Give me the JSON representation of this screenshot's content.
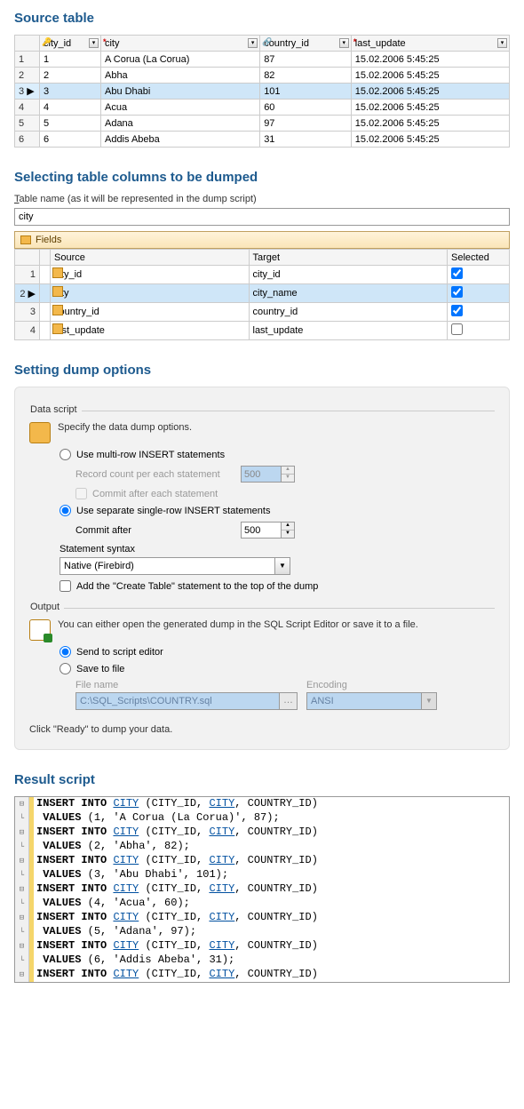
{
  "h_source": "Source table",
  "h_select": "Selecting table columns to be dumped",
  "h_options": "Setting dump options",
  "h_result": "Result script",
  "source_table": {
    "cols": [
      "city_id",
      "city",
      "country_id",
      "last_update"
    ],
    "rows": [
      {
        "n": "1",
        "city_id": "1",
        "city": "A Corua (La Corua)",
        "country_id": "87",
        "last_update": "15.02.2006 5:45:25"
      },
      {
        "n": "2",
        "city_id": "2",
        "city": "Abha",
        "country_id": "82",
        "last_update": "15.02.2006 5:45:25"
      },
      {
        "n": "3",
        "city_id": "3",
        "city": "Abu Dhabi",
        "country_id": "101",
        "last_update": "15.02.2006 5:45:25",
        "sel": true
      },
      {
        "n": "4",
        "city_id": "4",
        "city": "Acua",
        "country_id": "60",
        "last_update": "15.02.2006 5:45:25"
      },
      {
        "n": "5",
        "city_id": "5",
        "city": "Adana",
        "country_id": "97",
        "last_update": "15.02.2006 5:45:25"
      },
      {
        "n": "6",
        "city_id": "6",
        "city": "Addis Abeba",
        "country_id": "31",
        "last_update": "15.02.2006 5:45:25"
      }
    ]
  },
  "table_name_label": "Table name (as it will be represented in the dump script)",
  "table_name_value": "city",
  "fields_label": "Fields",
  "fields_cols": {
    "source": "Source",
    "target": "Target",
    "selected": "Selected"
  },
  "fields_rows": [
    {
      "n": "1",
      "source": "city_id",
      "target": "city_id",
      "selected": true
    },
    {
      "n": "2",
      "source": "city",
      "target": "city_name",
      "selected": true,
      "sel": true
    },
    {
      "n": "3",
      "source": "country_id",
      "target": "country_id",
      "selected": true
    },
    {
      "n": "4",
      "source": "last_update",
      "target": "last_update",
      "selected": false
    }
  ],
  "opts": {
    "data_script": "Data script",
    "specify": "Specify the data dump options.",
    "multi": "Use multi-row INSERT statements",
    "rec_count": "Record count per each statement",
    "rec_count_val": "500",
    "commit_each": "Commit after each statement",
    "single": "Use separate single-row INSERT statements",
    "commit_after": "Commit after",
    "commit_after_val": "500",
    "stmt_syntax": "Statement syntax",
    "stmt_syntax_val": "Native (Firebird)",
    "add_create": "Add the \"Create Table\" statement to the top of the dump",
    "output": "Output",
    "output_desc": "You can either open the generated dump in the SQL Script Editor or save it to a file.",
    "send_editor": "Send to script editor",
    "save_file": "Save to file",
    "file_name": "File name",
    "file_name_val": "C:\\SQL_Scripts\\COUNTRY.sql",
    "encoding": "Encoding",
    "encoding_val": "ANSI",
    "footer": "Click \"Ready\" to dump your data."
  },
  "script_rows": [
    {
      "id": 1,
      "city": "A Corua (La Corua)",
      "cid": 87
    },
    {
      "id": 2,
      "city": "Abha",
      "cid": 82
    },
    {
      "id": 3,
      "city": "Abu Dhabi",
      "cid": 101
    },
    {
      "id": 4,
      "city": "Acua",
      "cid": 60
    },
    {
      "id": 5,
      "city": "Adana",
      "cid": 97
    },
    {
      "id": 6,
      "city": "Addis Abeba",
      "cid": 31
    }
  ]
}
